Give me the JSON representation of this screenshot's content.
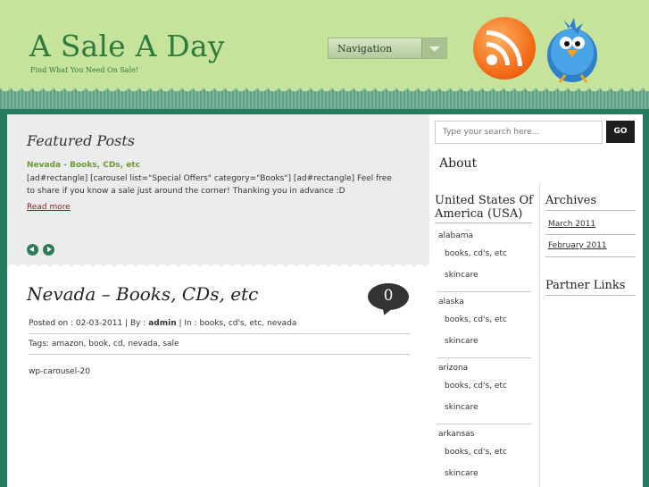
{
  "header": {
    "title": "A Sale A Day",
    "tagline": "Find What You Need On Sale!",
    "nav_label": "Navigation"
  },
  "featured": {
    "heading": "Featured Posts",
    "post_title": "Nevada - Books, CDs, etc",
    "excerpt": "[ad#rectangle] [carousel list=\"Special Offers\" category=\"Books\"] [ad#rectangle] Feel free to share if you know a sale just around the corner!  Thanking you in advance :D",
    "read_more": "Read more"
  },
  "post": {
    "title": "Nevada – Books, CDs, etc",
    "comment_count": "0",
    "meta_prefix": "Posted on : 02-03-2011 | By : ",
    "author": "admin",
    "meta_suffix": " | In : books, cd's, etc, nevada",
    "tags": "Tags: amazon, book, cd, nevada, sale",
    "body": "wp-carousel-20"
  },
  "sidebar": {
    "search_placeholder": "Type your search here...",
    "search_button": "GO",
    "about_title": "About",
    "states_title": "United States Of America (USA)",
    "states": [
      {
        "name": "alabama",
        "cats": [
          "books, cd's, etc",
          "skincare"
        ]
      },
      {
        "name": "alaska",
        "cats": [
          "books, cd's, etc",
          "skincare"
        ]
      },
      {
        "name": "arizona",
        "cats": [
          "books, cd's, etc",
          "skincare"
        ]
      },
      {
        "name": "arkansas",
        "cats": [
          "books, cd's, etc",
          "skincare"
        ]
      }
    ],
    "archives_title": "Archives",
    "archives": [
      "March 2011",
      "February 2011"
    ],
    "partner_title": "Partner Links"
  },
  "colors": {
    "header_bg": "#c6e39c",
    "frame": "#257a62",
    "title_green": "#2f7a3d",
    "link_red": "#8a1f1f"
  },
  "icons": [
    "rss-icon",
    "twitter-bird-icon",
    "prev-arrow-icon",
    "next-arrow-icon",
    "comment-bubble-icon"
  ]
}
